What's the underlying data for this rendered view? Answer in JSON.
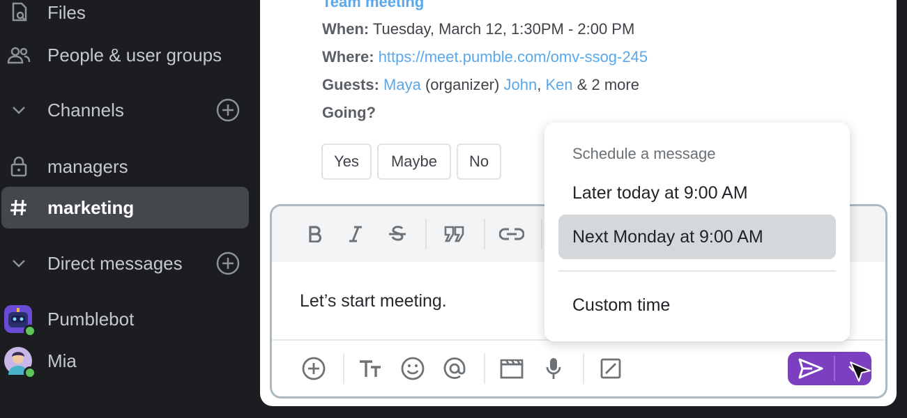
{
  "sidebar": {
    "files": "Files",
    "people": "People & user groups",
    "channels_header": "Channels",
    "channels": [
      {
        "label": "managers"
      },
      {
        "label": "marketing"
      }
    ],
    "dm_header": "Direct messages",
    "dms": [
      {
        "label": "Pumblebot"
      },
      {
        "label": "Mia"
      }
    ]
  },
  "event": {
    "title": "Team meeting",
    "when_label": "When:",
    "when_value": "Tuesday, March 12, 1:30PM - 2:00 PM",
    "where_label": "Where:",
    "where_value": "https://meet.pumble.com/omv-ssog-245",
    "guests_label": "Guests:",
    "guest1": "Maya",
    "guest1_role": "(organizer)",
    "guest2": "John",
    "guest_sep": ",",
    "guest3": "Ken",
    "guests_more": "& 2 more",
    "going": "Going?",
    "rsvp": [
      "Yes",
      "Maybe",
      "No"
    ]
  },
  "composer": {
    "text": "Let’s start meeting."
  },
  "schedule": {
    "header": "Schedule a message",
    "options": [
      "Later today at 9:00 AM",
      "Next Monday at 9:00 AM"
    ],
    "custom": "Custom time"
  },
  "colors": {
    "accent": "#7b3fbf",
    "link": "#5aa8ea",
    "online": "#5fc55a"
  }
}
